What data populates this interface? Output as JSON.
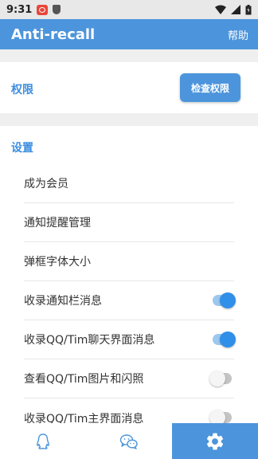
{
  "status_bar": {
    "time": "9:31"
  },
  "app_bar": {
    "title": "Anti-recall",
    "help_label": "帮助"
  },
  "permission": {
    "title": "权限",
    "check_button": "检查权限"
  },
  "settings": {
    "title": "设置",
    "items": [
      {
        "label": "成为会员"
      },
      {
        "label": "通知提醒管理"
      },
      {
        "label": "弹框字体大小"
      },
      {
        "label": "收录通知栏消息",
        "toggle": true
      },
      {
        "label": "收录QQ/Tim聊天界面消息",
        "toggle": true
      },
      {
        "label": "查看QQ/Tim图片和闪照",
        "toggle": false
      },
      {
        "label": "收录QQ/Tim主界面消息",
        "toggle": false
      }
    ]
  },
  "bottom_nav": {
    "tabs": [
      {
        "icon": "qq-penguin-icon",
        "active": false
      },
      {
        "icon": "wechat-icon",
        "active": false
      },
      {
        "icon": "gear-icon",
        "active": true
      }
    ]
  },
  "colors": {
    "primary": "#4c95dc",
    "accent": "#3b8ee0",
    "toggle_on": "#2f8fe9"
  }
}
